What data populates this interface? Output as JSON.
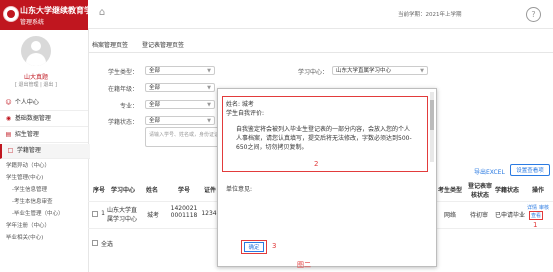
{
  "brand": {
    "title": "山东大学继续教育学院",
    "subtitle": "管理系统"
  },
  "user": {
    "name": "山大真题",
    "info": "[ 退出管理 | 退出 ]"
  },
  "sidebar": {
    "items": [
      {
        "label": "个人中心",
        "icon": "person-icon"
      },
      {
        "label": "基础数据管理",
        "icon": "database-icon"
      },
      {
        "label": "招生管理",
        "icon": "clipboard-icon"
      },
      {
        "label": "学籍管理",
        "icon": "file-icon"
      }
    ],
    "subitems": [
      "学籍异动（中心）",
      "学生管理(中心)",
      "-学生信息管理",
      "-考生本信息审查",
      "-毕业生管理（中心）",
      "学年注册（中心）",
      "毕业相关(中心)"
    ]
  },
  "topbar": {
    "semester": "当前学期：2021年上学期",
    "help": "?"
  },
  "tabs": [
    "档案管理页签",
    "登记表管理页签"
  ],
  "filters": {
    "student_type": {
      "label": "学生类型：",
      "value": "全部"
    },
    "learning_center": {
      "label": "学习中心：",
      "value": "山东大学直属学习中心"
    },
    "level": {
      "label": "在籍年级：",
      "value": "全部"
    },
    "major": {
      "label": "专业：",
      "value": "全部"
    },
    "status": {
      "label": "学籍状态：",
      "value": "全部"
    },
    "partial": {
      "label": "层次：",
      "value": "全部"
    },
    "textarea_placeholder": "请输入学号、姓名或，身份证证件号"
  },
  "actions": {
    "export": "导出EXCEL",
    "config": "设置查看项"
  },
  "table": {
    "headers": [
      "序号",
      "学习中心",
      "姓名",
      "学号",
      "证件",
      "考生类型",
      "登记表审核状态",
      "学籍状态",
      "操作"
    ],
    "row": {
      "index": "1",
      "center": "山东大学直属学习中心",
      "name": "城考",
      "id": "14200210001118",
      "cert": "1234",
      "stu_type": "网络",
      "review": "待初审",
      "status": "已申请毕业",
      "op_detail": "详情",
      "op_audit": "审核",
      "op_view": "查看",
      "op_marker": "1"
    },
    "select_all": "全选"
  },
  "dialog": {
    "name_label": "姓名: 城考",
    "self_eval_label": "学生自我评价:",
    "notice": "自我鉴定将会被列入毕业生登记表的一部分内容，会放入您的个人人事档案，请您认真填写，提交后将无法修改，字数必须达到500-650之间，切勿拷贝复制。",
    "marker2": "2",
    "unit_label": "单位意见:",
    "confirm": "确定",
    "marker3": "3"
  },
  "caption": "图二"
}
